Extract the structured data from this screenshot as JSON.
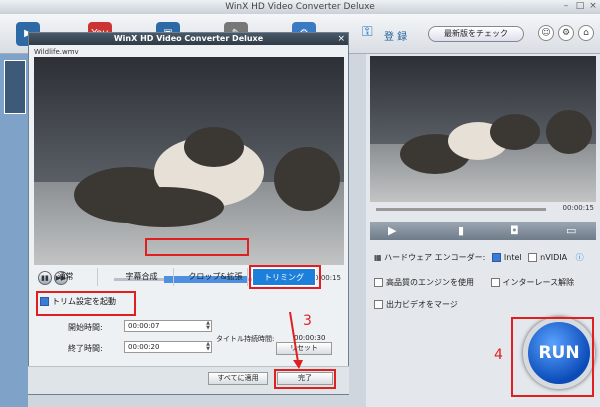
{
  "main_window": {
    "title": "WinX HD Video Converter Deluxe",
    "register_label": "登 録",
    "update_button": "最新版をチェック",
    "toolbar_icon_you": "You"
  },
  "right_panel": {
    "duration_time": "00:00:15",
    "hw_encoder_label": "ハードウェア エンコーダー:",
    "intel_label": "Intel",
    "nvidia_label": "nVIDIA",
    "high_quality_label": "高品質のエンジンを使用",
    "deinterlace_label": "インターレース解除",
    "merge_label": "出力ビデオをマージ",
    "run_label": "RUN",
    "step_number": "4"
  },
  "dialog": {
    "title": "WinX HD Video Converter Deluxe",
    "file_name": "Wildlife.wmv",
    "duration": "00:00:15",
    "tabs": [
      {
        "label": "通常"
      },
      {
        "label": "字幕合成"
      },
      {
        "label": "クロップ&拡張"
      },
      {
        "label": "トリミング"
      }
    ],
    "trim_enable_label": "トリム設定を起動",
    "start_label": "開始時間:",
    "start_value": "00:00:07",
    "end_label": "終了時間:",
    "end_value": "00:00:20",
    "title_duration_label": "タイトル持続時間:",
    "title_duration_value": "00:00:30",
    "reset_button": "リセット",
    "apply_all_button": "すべてに適用",
    "done_button": "完了",
    "step_number": "3"
  },
  "colors": {
    "accent": "#1c7fdb",
    "highlight": "#e02020"
  }
}
